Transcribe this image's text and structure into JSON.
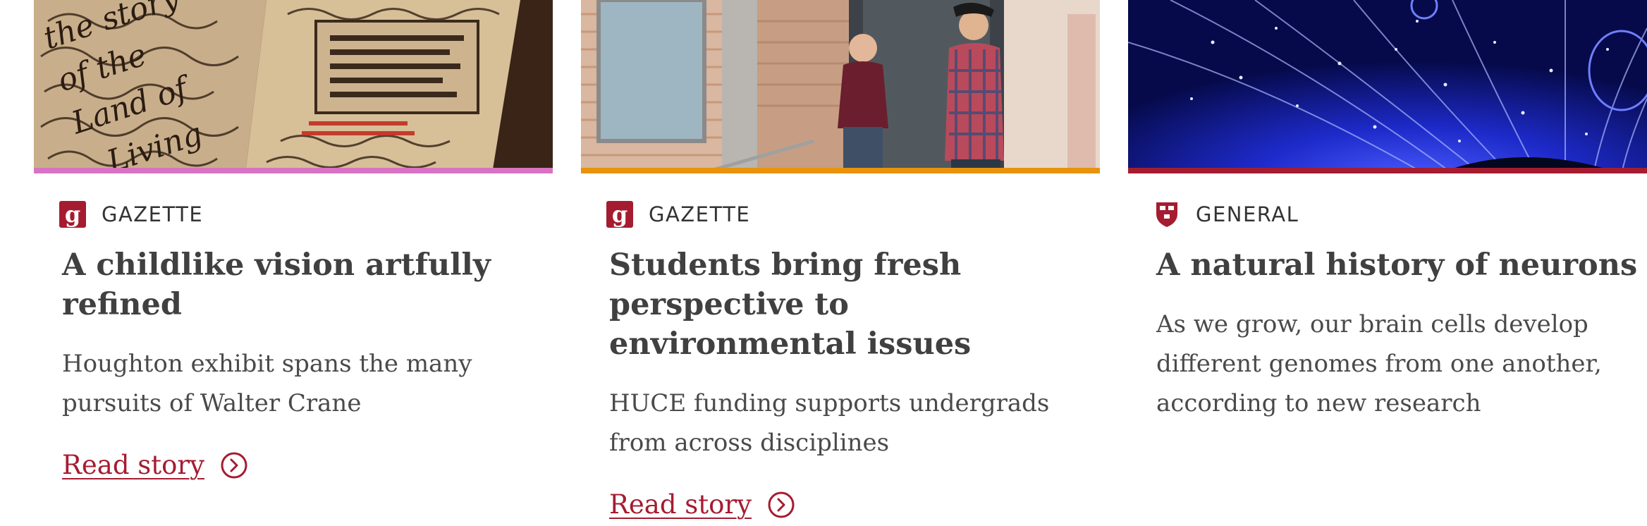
{
  "cards": [
    {
      "accent_color": "#d873c4",
      "image": "illuminated-book-photo",
      "source": {
        "icon": "gazette-g-icon",
        "logo_text": "g",
        "label": "GAZETTE"
      },
      "title": "A childlike vision artfully refined",
      "summary": "Houghton exhibit spans the many pursuits of Walter Crane",
      "link_label": "Read story",
      "link_icon": "chevron-circle-right-icon"
    },
    {
      "accent_color": "#e8930b",
      "image": "students-portrait-photo",
      "source": {
        "icon": "gazette-g-icon",
        "logo_text": "g",
        "label": "GAZETTE"
      },
      "title": "Students bring fresh perspective to environmental issues",
      "summary": "HUCE funding supports undergrads from across disciplines",
      "link_label": "Read story",
      "link_icon": "chevron-circle-right-icon"
    },
    {
      "accent_color": "#a51c30",
      "image": "neurons-microscopy-photo",
      "source": {
        "icon": "harvard-shield-icon",
        "label": "GENERAL"
      },
      "title": "A natural history of neurons",
      "summary": "As we grow, our brain cells develop different genomes from one another, according to new research"
    }
  ],
  "colors": {
    "brand_crimson": "#a51c30",
    "text_dark": "#404040"
  }
}
